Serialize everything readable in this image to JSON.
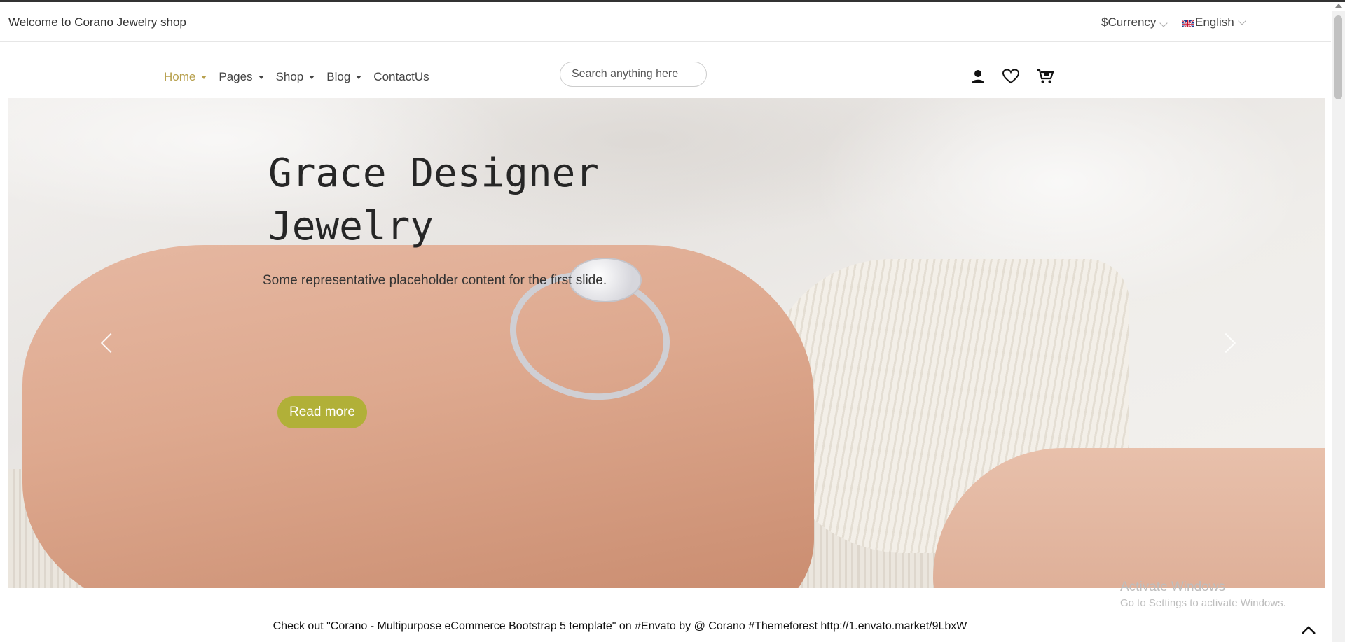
{
  "topbar": {
    "welcome": "Welcome to Corano Jewelry shop",
    "currency": "$Currency",
    "language": "English"
  },
  "nav": {
    "items": [
      {
        "label": "Home",
        "active": true,
        "dropdown": true
      },
      {
        "label": "Pages",
        "active": false,
        "dropdown": true
      },
      {
        "label": "Shop",
        "active": false,
        "dropdown": true
      },
      {
        "label": "Blog",
        "active": false,
        "dropdown": true
      },
      {
        "label": "ContactUs",
        "active": false,
        "dropdown": false
      }
    ]
  },
  "search": {
    "placeholder": "Search anything here"
  },
  "header_icons": [
    "user-icon",
    "heart-icon",
    "cart-icon"
  ],
  "hero": {
    "title": "Grace Designer Jewelry",
    "subtitle": "Some representative placeholder content for the first slide.",
    "button": "Read more"
  },
  "footer_note": "Check out \"Corano - Multipurpose eCommerce Bootstrap 5 template\" on #Envato by @ Corano #Themeforest http://1.envato.market/9LbxW",
  "windows_watermark": {
    "line1": "Activate Windows",
    "line2": "Go to Settings to activate Windows."
  },
  "colors": {
    "accent": "#b7a04d",
    "button": "#b1b038",
    "text": "#333333"
  }
}
